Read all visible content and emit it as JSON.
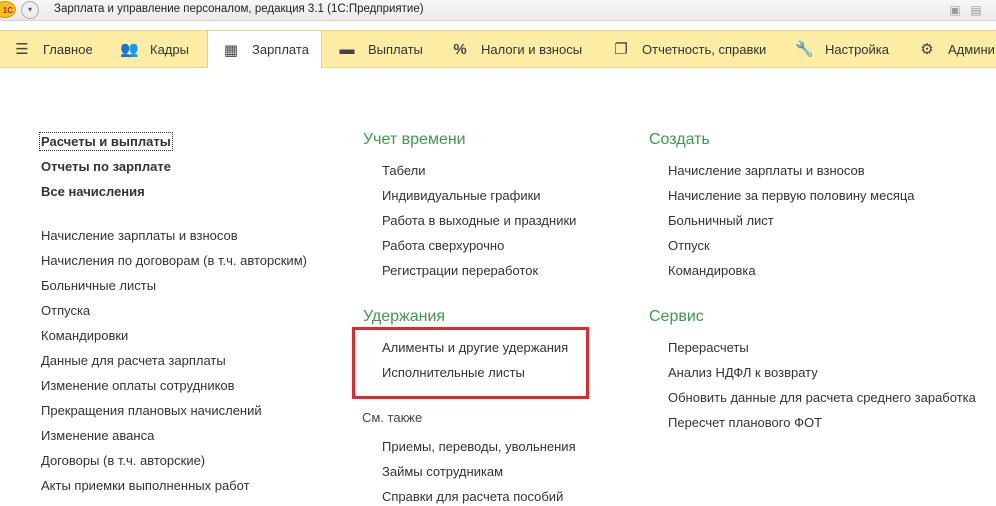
{
  "window": {
    "logo_text": "1С",
    "title": "Зарплата и управление персоналом, редакция 3.1  (1С:Предприятие)"
  },
  "sections": [
    {
      "label": "Главное",
      "icon": "hamburger-icon"
    },
    {
      "label": "Кадры",
      "icon": "people-icon"
    },
    {
      "label": "Зарплата",
      "icon": "calculator-icon",
      "active": true
    },
    {
      "label": "Выплаты",
      "icon": "wallet-icon"
    },
    {
      "label": "Налоги и взносы",
      "icon": "percent-icon"
    },
    {
      "label": "Отчетность, справки",
      "icon": "documents-icon"
    },
    {
      "label": "Настройка",
      "icon": "wrench-icon"
    },
    {
      "label": "Админи",
      "icon": "gear-icon"
    }
  ],
  "left_column": {
    "primary": [
      "Расчеты и выплаты",
      "Отчеты по зарплате",
      "Все начисления"
    ],
    "items": [
      "Начисление зарплаты и взносов",
      "Начисления по договорам (в т.ч. авторским)",
      "Больничные листы",
      "Отпуска",
      "Командировки",
      "Данные для расчета зарплаты",
      "Изменение оплаты сотрудников",
      "Прекращения плановых начислений",
      "Изменение аванса",
      "Договоры (в т.ч. авторские)",
      "Акты приемки выполненных работ"
    ]
  },
  "middle_column": {
    "time_heading": "Учет времени",
    "time_items": [
      "Табели",
      "Индивидуальные графики",
      "Работа в выходные и праздники",
      "Работа сверхурочно",
      "Регистрации переработок"
    ],
    "deductions_heading": "Удержания",
    "deductions_items": [
      "Алименты и другие удержания",
      "Исполнительные листы"
    ],
    "see_also_heading": "См. также",
    "see_also_items": [
      "Приемы, переводы, увольнения",
      "Займы сотрудникам",
      "Справки для расчета пособий"
    ]
  },
  "right_column": {
    "create_heading": "Создать",
    "create_items": [
      "Начисление зарплаты и взносов",
      "Начисление за первую половину месяца",
      "Больничный лист",
      "Отпуск",
      "Командировка"
    ],
    "service_heading": "Сервис",
    "service_items": [
      "Перерасчеты",
      "Анализ НДФЛ к возврату",
      "Обновить данные для расчета среднего заработка",
      "Пересчет планового ФОТ"
    ]
  },
  "colors": {
    "panel_bg": "#fbeda3",
    "group_heading": "#3c9a4e",
    "highlight_box": "#e0282e"
  }
}
